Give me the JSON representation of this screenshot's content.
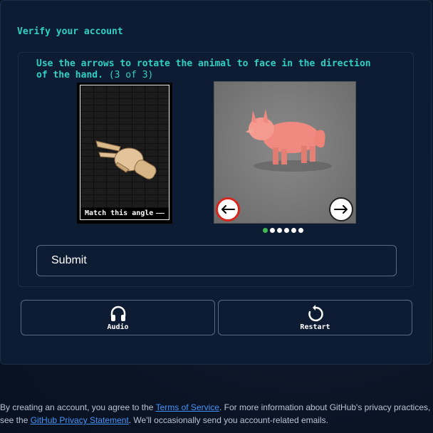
{
  "header": {
    "title": "Verify your account"
  },
  "challenge": {
    "instruction": "Use the arrows to rotate the animal to face in the direction of the hand.",
    "progress": "(3 of 3)",
    "reference_caption": "Match this angle",
    "carousel": {
      "total": 6,
      "active_index": 0
    },
    "icons": {
      "left": "arrow-left-icon",
      "right": "arrow-right-icon"
    },
    "colors": {
      "left_arrow_border": "#d9261c",
      "active_dot": "#3fb950"
    }
  },
  "form": {
    "submit_label": "Submit"
  },
  "tools": {
    "audio_label": "Audio",
    "restart_label": "Restart"
  },
  "footer": {
    "text_1": "By creating an account, you agree to the ",
    "terms_link": "Terms of Service",
    "text_2": ". For more information about GitHub's privacy practices, see the ",
    "privacy_link": "GitHub Privacy Statement",
    "text_3": ". We'll occasionally send you account-related emails."
  }
}
